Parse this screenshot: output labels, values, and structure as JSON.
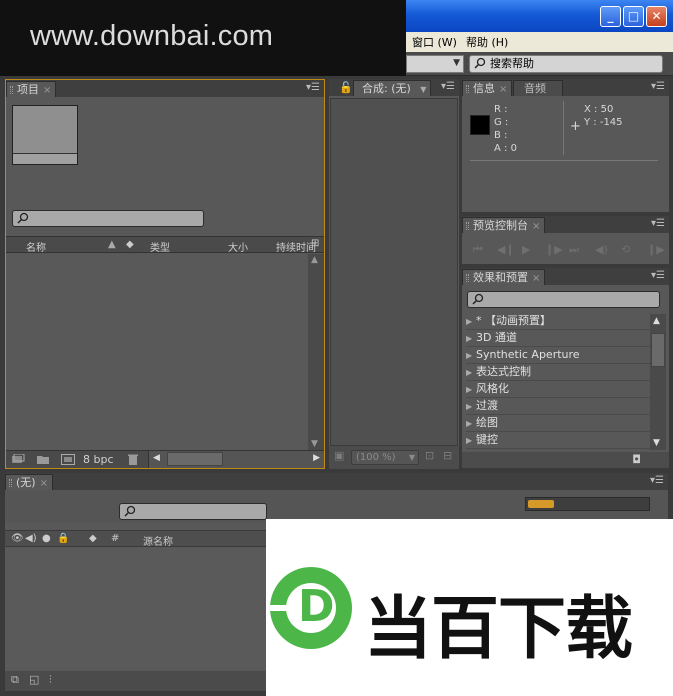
{
  "watermark": {
    "top_text": "www.downbai.com",
    "bottom_text": "当百下载",
    "logo_letter": "D",
    "logo_color": "#4cb648"
  },
  "window": {
    "minimize": "_",
    "maximize": "□",
    "close": "✕"
  },
  "menubar": {
    "items": [
      "窗口 (W)",
      "帮助 (H)"
    ]
  },
  "toolbar": {
    "help_search_placeholder": "搜索帮助"
  },
  "project_panel": {
    "tab": "项目",
    "columns": {
      "name": "名称",
      "type": "类型",
      "size": "大小",
      "duration": "持续时间"
    },
    "bpc": "8 bpc"
  },
  "comp_panel": {
    "tab": "合成: (无)",
    "zoom": "(100 %)"
  },
  "info_panel": {
    "tabs": [
      "信息",
      "音频"
    ],
    "r": "R :",
    "g": "G :",
    "b": "B :",
    "a": "A : 0",
    "x": "X : 50",
    "y": "Y : -145"
  },
  "preview_panel": {
    "tab": "预览控制台"
  },
  "effects_panel": {
    "tab": "效果和预置",
    "items": [
      "* 【动画预置】",
      "3D 通道",
      "Synthetic Aperture",
      "表达式控制",
      "风格化",
      "过渡",
      "绘图",
      "键控"
    ]
  },
  "timeline_panel": {
    "tab": "(无)",
    "columns": {
      "number": "#",
      "source_name": "源名称"
    }
  },
  "colors": {
    "panel_bg": "#585858",
    "active_border": "#c18a17",
    "titlebar_blue": "#1559d6"
  }
}
